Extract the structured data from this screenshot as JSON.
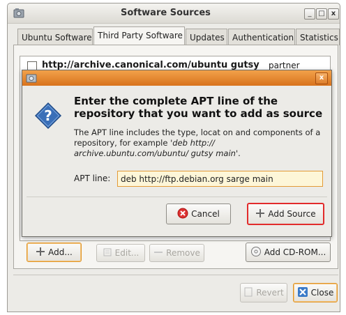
{
  "window": {
    "title": "Software Sources"
  },
  "tabs": [
    {
      "label": "Ubuntu Software"
    },
    {
      "label": "Third Party Software"
    },
    {
      "label": "Updates"
    },
    {
      "label": "Authentication"
    },
    {
      "label": "Statistics"
    }
  ],
  "sources": [
    {
      "url": "http://archive.canonical.com/ubuntu gutsy",
      "suffix": "partner",
      "checked": false
    }
  ],
  "dialog": {
    "heading": "Enter the complete APT line of the repository that you want to add as source",
    "description_plain": "The APT line includes the type, locat on and components of a repository, for example  ",
    "description_example": "'deb http:// archive.ubuntu.com/ubuntu/ gutsy main'",
    "description_end": ".",
    "apt_label": "APT line:",
    "apt_value": "deb http://ftp.debian.org sarge main",
    "cancel_label": "Cancel",
    "add_source_label": "Add Source"
  },
  "buttons": {
    "add": "Add...",
    "edit": "Edit...",
    "remove": "Remove",
    "add_cdrom": "Add CD-ROM...",
    "revert": "Revert",
    "close": "Close"
  },
  "colors": {
    "dialog_titlebar": "#e07d24",
    "highlight_border": "#e22b2b",
    "input_border": "#e39a36"
  }
}
